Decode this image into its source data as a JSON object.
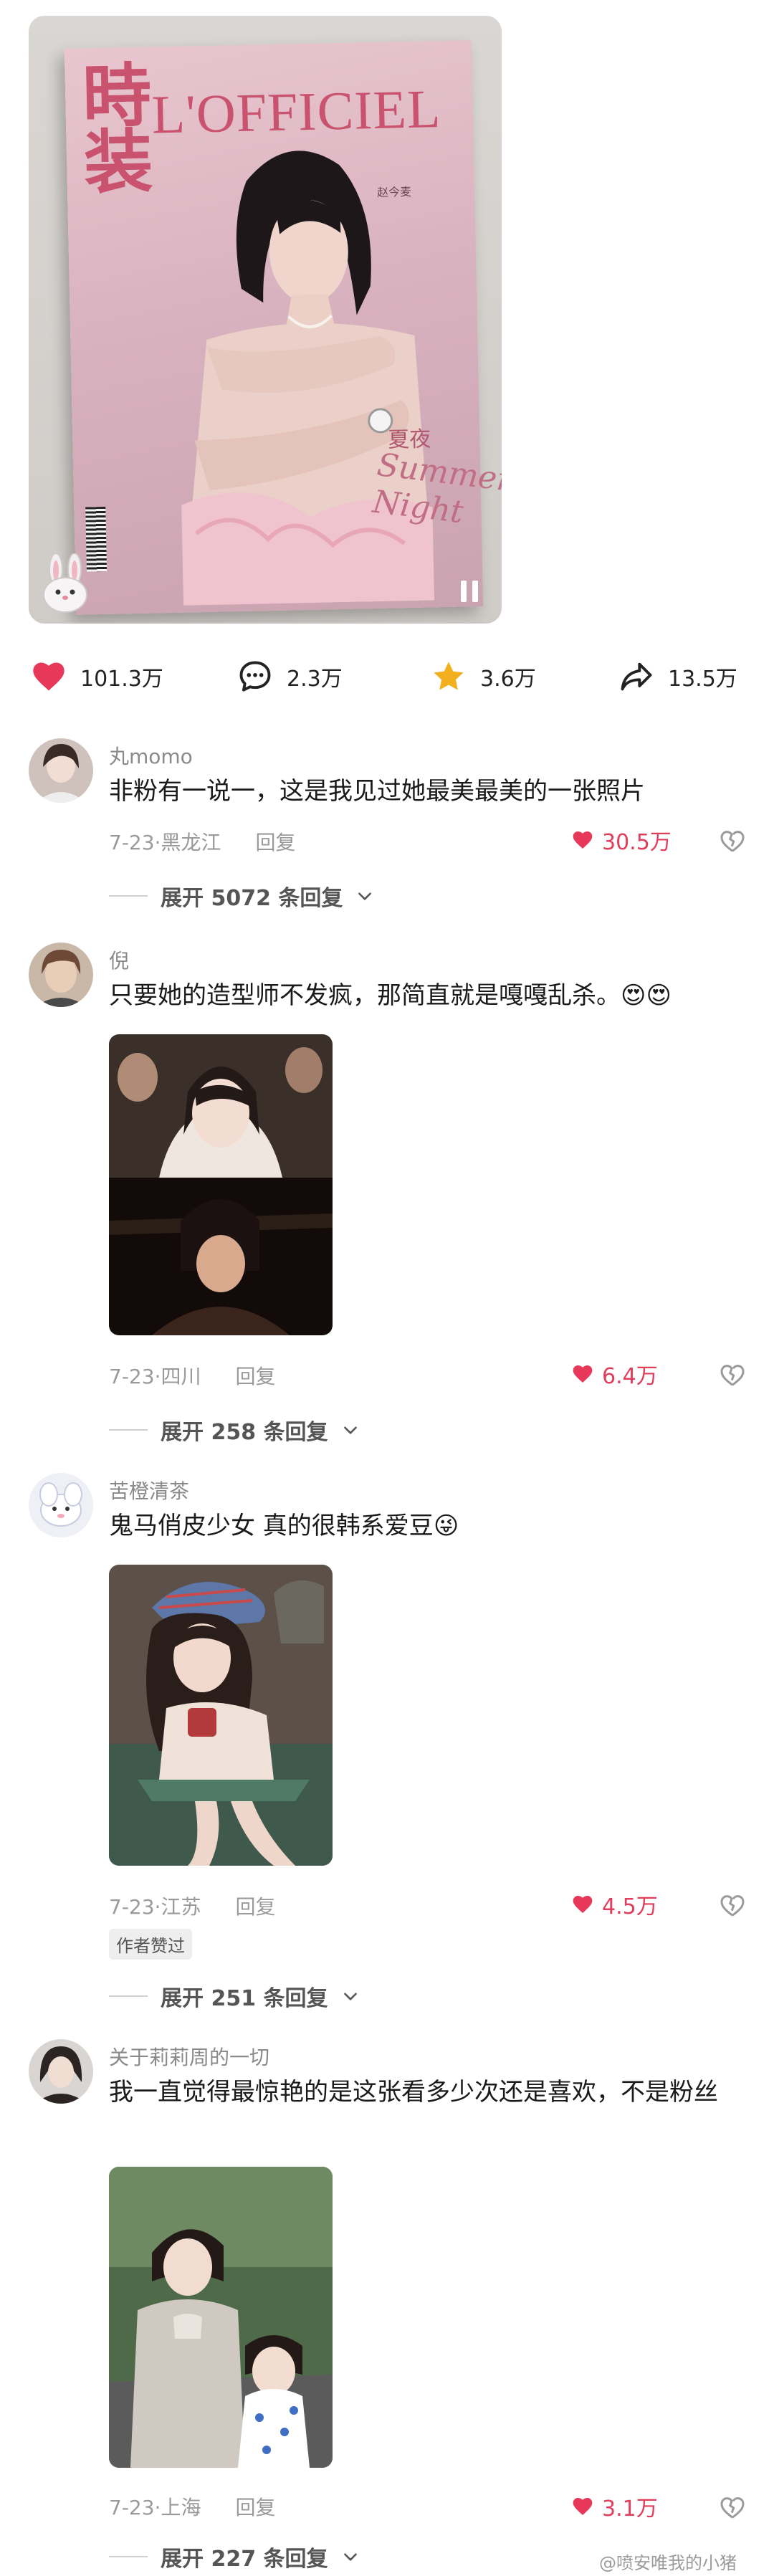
{
  "post": {
    "cover": {
      "magazine_cn": "時装",
      "magazine_brand": "L'OFFICIEL",
      "issue_cn": "夏夜",
      "issue_script": "Summer Night",
      "cover_sub": "赵今麦"
    },
    "stats": {
      "likes": "101.3万",
      "comments": "2.3万",
      "favorites": "3.6万",
      "shares": "13.5万"
    }
  },
  "comments": [
    {
      "username": "丸momo",
      "text": "非粉有一说一，这是我见过她最美最美的一张照片",
      "date": "7-23",
      "location": "黑龙江",
      "reply_label": "回复",
      "likes": "30.5万",
      "expand_label": "展开 5072 条回复"
    },
    {
      "username": "倪",
      "text": "只要她的造型师不发疯，那简直就是嘎嘎乱杀。",
      "emojis": "😍😍",
      "date": "7-23",
      "location": "四川",
      "reply_label": "回复",
      "likes": "6.4万",
      "expand_label": "展开 258 条回复"
    },
    {
      "username": "苦橙清茶",
      "text": "鬼马俏皮少女 真的很韩系爱豆",
      "emojis": "😜",
      "date": "7-23",
      "location": "江苏",
      "reply_label": "回复",
      "likes": "4.5万",
      "badge": "作者赞过",
      "expand_label": "展开 251 条回复"
    },
    {
      "username": "关于莉莉周的一切",
      "text": "我一直觉得最惊艳的是这张看多少次还是喜欢，不是粉丝",
      "date": "7-23",
      "location": "上海",
      "reply_label": "回复",
      "likes": "3.1万",
      "expand_label": "展开 227 条回复"
    }
  ],
  "watermark": "@喷安唯我的小猪",
  "colors": {
    "like_red": "#e03e5b",
    "star_gold": "#f2b01e",
    "meta_gray": "#9a9a9a"
  },
  "icons": [
    "heart-icon",
    "comment-bubble-icon",
    "star-icon",
    "share-arrow-icon",
    "pause-icon",
    "dislike-heart-icon",
    "chevron-down-icon",
    "rabbit-sticker-icon"
  ]
}
